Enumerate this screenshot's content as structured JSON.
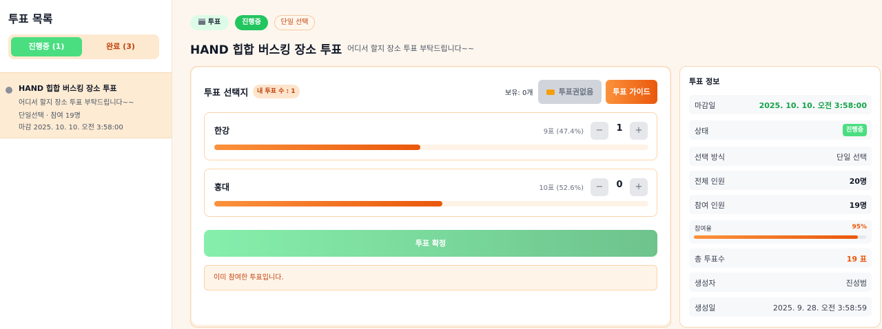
{
  "sidebar": {
    "title": "투표 목록",
    "tabs": [
      {
        "label": "진행중 (1)"
      },
      {
        "label": "완료 (3)"
      }
    ],
    "items": [
      {
        "title": "HAND 힙합 버스킹 장소 투표",
        "description": "어디서 할지 장소 투표 부탁드립니다~~",
        "meta": "단일선택 · 참여 19명",
        "deadline": "마감 2025. 10. 10. 오전 3:58:00"
      }
    ]
  },
  "header": {
    "badges": {
      "vote": "투표",
      "vote_icon": "clapperboard-icon",
      "status": "진행중",
      "mode": "단일 선택"
    },
    "title": "HAND 힙합 버스킹 장소 투표",
    "description": "어디서 할지 장소 투표 부탁드립니다~~"
  },
  "vote": {
    "section_title": "투표 선택지",
    "my_votes": "내 투표 수 : 1",
    "holding": "보유: 0개",
    "ticket_button": "투표권없음",
    "ticket_icon": "ticket-icon",
    "guide_button": "투표 가이드",
    "options": [
      {
        "name": "한강",
        "count_text": "9표 (47.4%)",
        "share": 0.474,
        "my_count": "1"
      },
      {
        "name": "홍대",
        "count_text": "10표 (52.6%)",
        "share": 0.526,
        "my_count": "0"
      }
    ],
    "stepper": {
      "minus": "−",
      "plus": "+"
    },
    "confirm_button": "투표 확정",
    "notice": "이미 참여한 투표입니다."
  },
  "info": {
    "title": "투표 정보",
    "deadline_label": "마감일",
    "deadline_value": "2025. 10. 10. 오전 3:58:00",
    "status_label": "상태",
    "status_value": "진행중",
    "method_label": "선택 방식",
    "method_value": "단일 선택",
    "total_label": "전체 인원",
    "total_value": "20명",
    "participants_label": "참여 인원",
    "participants_value": "19명",
    "rate_label": "참여율",
    "rate_value": "95%",
    "rate": 0.95,
    "votes_label": "총 투표수",
    "votes_value": "19 표",
    "creator_label": "생성자",
    "creator_value": "진성범",
    "created_label": "생성일",
    "created_value": "2025. 9. 28. 오전 3:58:59"
  },
  "colors": {
    "accent_orange": "#ea580c",
    "accent_green": "#22c55e",
    "background": "#fdf6ee"
  }
}
